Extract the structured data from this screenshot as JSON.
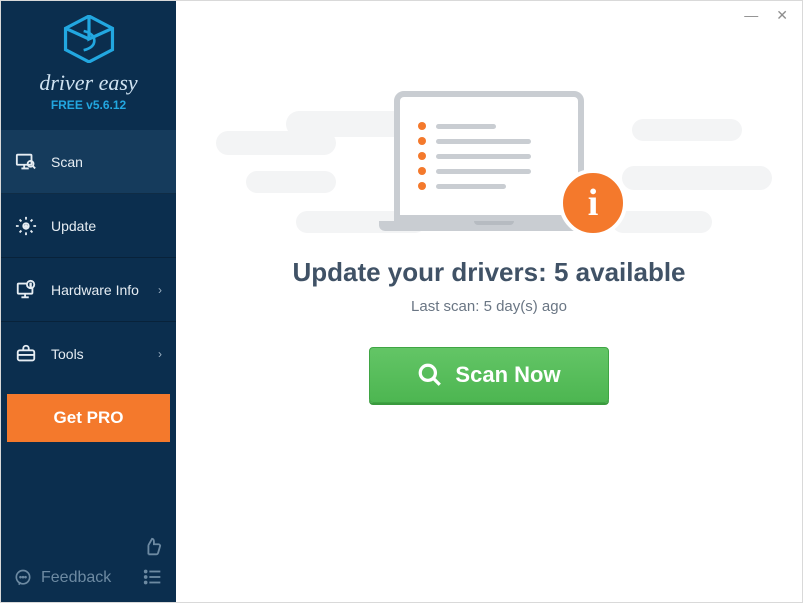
{
  "window": {
    "minimize": "—",
    "close": "✕"
  },
  "brand": {
    "name": "driver easy",
    "version": "FREE v5.6.12"
  },
  "nav": {
    "scan": "Scan",
    "update": "Update",
    "hardware": "Hardware Info",
    "tools": "Tools"
  },
  "getpro": "Get PRO",
  "feedback": "Feedback",
  "main": {
    "headline": "Update your drivers: 5 available",
    "subline": "Last scan: 5 day(s) ago",
    "scan_button": "Scan Now"
  }
}
